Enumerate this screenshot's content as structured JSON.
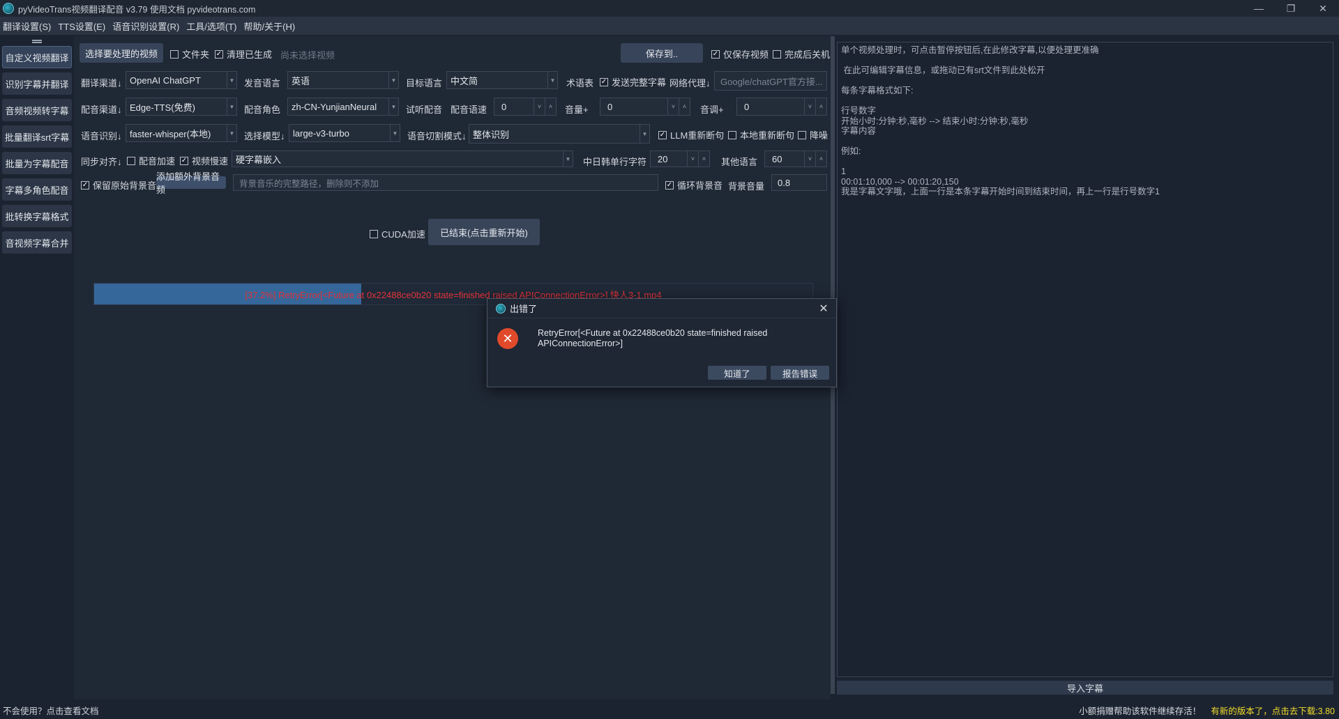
{
  "titlebar": {
    "title": "pyVideoTrans视频翻译配音 v3.79  使用文档  pyvideotrans.com",
    "minimize": "—",
    "restore": "❐",
    "close": "✕"
  },
  "menu": [
    "翻译设置(S)",
    "TTS设置(E)",
    "语音识别设置(R)",
    "工具/选项(T)",
    "帮助/关于(H)"
  ],
  "sidebar": [
    "自定义视频翻译",
    "识别字幕并翻译",
    "音频视频转字幕",
    "批量翻译srt字幕",
    "批量为字幕配音",
    "字幕多角色配音",
    "批转换字幕格式",
    "音视频字幕合并"
  ],
  "row1": {
    "select_video": "选择要处理的视频",
    "folder": "文件夹",
    "clear_generated": "清理已生成",
    "no_video": "尚未选择视频",
    "save_to": "保存到..",
    "only_save_video": "仅保存视频",
    "shutdown_after": "完成后关机"
  },
  "row2": {
    "translate_channel_label": "翻译渠道↓",
    "translate_channel": "OpenAI ChatGPT",
    "source_lang_label": "发音语言",
    "source_lang": "英语",
    "target_lang_label": "目标语言",
    "target_lang": "中文简",
    "glossary": "术语表",
    "send_full_subtitle": "发送完整字幕",
    "proxy_label": "网络代理↓",
    "proxy_placeholder": "Google/chatGPT官方接..."
  },
  "row3": {
    "tts_channel_label": "配音渠道↓",
    "tts_channel": "Edge-TTS(免费)",
    "voice_role_label": "配音角色",
    "voice_role": "zh-CN-YunjianNeural",
    "preview": "试听配音",
    "speed_label": "配音语速",
    "speed": "0",
    "volume_label": "音量+",
    "volume": "0",
    "pitch_label": "音调+",
    "pitch": "0"
  },
  "row4": {
    "asr_label": "语音识别↓",
    "asr": "faster-whisper(本地)",
    "model_label": "选择模型↓",
    "model": "large-v3-turbo",
    "split_mode_label": "语音切割模式↓",
    "split_mode": "整体识别",
    "llm_resplit": "LLM重新断句",
    "local_resplit": "本地重新断句",
    "denoise": "降噪"
  },
  "row5": {
    "align_label": "同步对齐↓",
    "tts_speedup": "配音加速",
    "video_slowdown": "视频慢速",
    "subtitle_mode": "硬字幕嵌入",
    "cjk_chars_label": "中日韩单行字符",
    "cjk_chars": "20",
    "other_lang_label": "其他语言",
    "other_lang": "60"
  },
  "row6": {
    "keep_bg": "保留原始背景音",
    "add_bg": "添加额外背景音频",
    "bg_placeholder": "背景音乐的完整路径，删除则不添加",
    "loop_bg": "循环背景音",
    "bg_volume_label": "背景音量",
    "bg_volume": "0.8"
  },
  "actions": {
    "cuda": "CUDA加速",
    "start": "已结束(点击重新开始)"
  },
  "progress": {
    "percent": 37.2,
    "text": "[37.2%]  RetryError[<Future at 0x22488ce0b20 state=finished raised APIConnectionError>]   快人3-1.mp4"
  },
  "right_panel": {
    "lines": [
      "单个视频处理时，可点击暂停按钮后,在此修改字幕,以便处理更准确",
      "",
      " 在此可编辑字幕信息，或拖动已有srt文件到此处松开",
      "",
      "每条字幕格式如下:",
      "",
      "行号数字",
      "开始小时:分钟:秒,毫秒 --> 结束小时:分钟:秒,毫秒",
      "字幕内容",
      "",
      "例如:",
      "",
      "1",
      "00:01:10,000 --> 00:01:20,150",
      "我是字幕文字哦，上面一行是本条字幕开始时间到结束时间，再上一行是行号数字1"
    ],
    "import_button": "导入字幕"
  },
  "status": {
    "help": "不会使用？点击查看文档",
    "donate": "小额捐赠帮助该软件继续存活！",
    "update": "有新的版本了，点击去下载:3.80"
  },
  "dialog": {
    "title": "出错了",
    "message": "RetryError[<Future at 0x22488ce0b20 state=finished raised APIConnectionError>]",
    "ok": "知道了",
    "report": "报告错误"
  }
}
